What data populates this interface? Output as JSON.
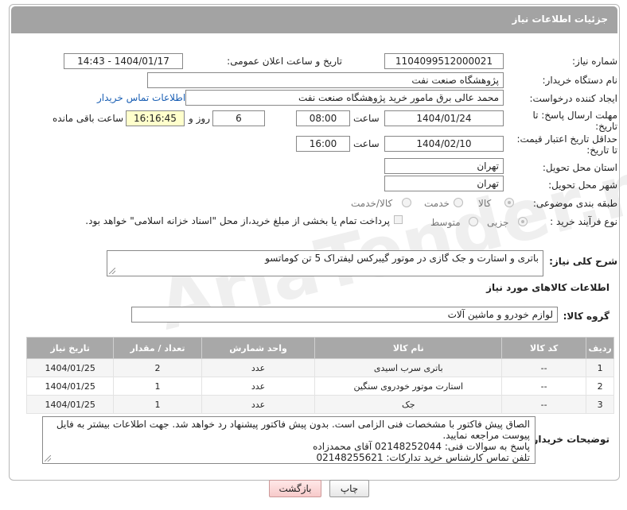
{
  "header": {
    "title": "جزئیات اطلاعات نیاز"
  },
  "fields": {
    "need_number_label": "شماره نیاز:",
    "need_number": "1104099512000021",
    "announce_label": "تاریخ و ساعت اعلان عمومی:",
    "announce_value": "1404/01/17 - 14:43",
    "buyer_org_label": "نام دستگاه خریدار:",
    "buyer_org": "پژوهشگاه صنعت نفت",
    "creator_label": "ایجاد کننده درخواست:",
    "creator": "محمد عالی برق مامور خرید پژوهشگاه صنعت نفت",
    "contact_link": "اطلاعات تماس خریدار",
    "deadline_label_1": "مهلت ارسال پاسخ: تا",
    "deadline_label_2": "تاریخ:",
    "deadline_date": "1404/01/24",
    "time_label": "ساعت",
    "deadline_time": "08:00",
    "days_value": "6",
    "days_label": "روز و",
    "remaining_time": "16:16:45",
    "remaining_label": "ساعت باقی مانده",
    "validity_label_1": "حداقل تاریخ اعتبار قیمت:",
    "validity_label_2": "تا تاریخ:",
    "validity_date": "1404/02/10",
    "validity_time": "16:00",
    "province_label": "استان محل تحویل:",
    "province": "تهران",
    "city_label": "شهر محل تحویل:",
    "city": "تهران",
    "category_label": "طبقه بندی موضوعی:",
    "category_options": [
      "کالا",
      "خدمت",
      "کالا/خدمت"
    ],
    "process_label": "نوع فرآیند خرید :",
    "process_options": [
      "جزیی",
      "متوسط"
    ],
    "payment_note": "پرداخت تمام یا بخشی از مبلغ خرید،از محل \"اسناد خزانه اسلامی\" خواهد بود."
  },
  "description": {
    "label": "شرح کلی نیاز:",
    "value": "باتری و استارت و جک گازی در موتور گیبرکس لیفتراک 5 تن کوماتسو"
  },
  "goods": {
    "section_title": "اطلاعات کالاهای مورد نیاز",
    "group_label": "گروه کالا:",
    "group_value": "لوازم خودرو و ماشین آلات",
    "columns": [
      "ردیف",
      "کد کالا",
      "نام کالا",
      "واحد شمارش",
      "تعداد / مقدار",
      "تاریخ نیاز"
    ],
    "rows": [
      [
        "1",
        "--",
        "باتری سرب اسیدی",
        "عدد",
        "2",
        "1404/01/25"
      ],
      [
        "2",
        "--",
        "استارت موتور خودروی سنگین",
        "عدد",
        "1",
        "1404/01/25"
      ],
      [
        "3",
        "--",
        "جک",
        "عدد",
        "1",
        "1404/01/25"
      ]
    ]
  },
  "buyer_notes": {
    "label": "توضیحات خریدار:",
    "lines": [
      "الصاق پیش فاکتور با مشخصات فنی الزامی است. بدون پیش فاکتور پیشنهاد رد خواهد شد. جهت اطلاعات بیشتر به فایل",
      "پیوست مراجعه نمایید.",
      "پاسخ به سوالات فنی: 02148252044 آقای محمدزاده",
      "تلفن تماس کارشناس خرید تدارکات: 02148255621"
    ]
  },
  "buttons": {
    "print": "چاپ",
    "back": "بازگشت"
  },
  "watermark": "AriaTender.net"
}
